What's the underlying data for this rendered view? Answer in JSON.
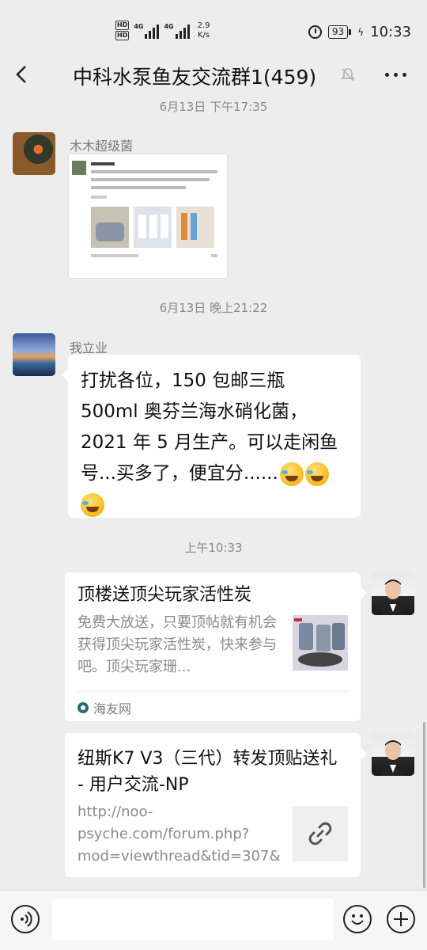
{
  "status_bar": {
    "hd1": "HD",
    "hd2": "HD",
    "net1": "4G",
    "net2": "4G",
    "speed_value": "2.9",
    "speed_unit": "K/s",
    "battery": "93",
    "time": "10:33"
  },
  "header": {
    "title": "中科水泵鱼友交流群1(459)"
  },
  "messages": {
    "time1": "6月13日 下午17:35",
    "msg1": {
      "sender": "木木超级菌",
      "type": "image"
    },
    "time2": "6月13日 晚上21:22",
    "msg2": {
      "sender": "我立业",
      "text": "打扰各位，150 包邮三瓶 500ml 奥芬兰海水硝化菌，2021 年 5 月生产。可以走闲鱼号...买多了，便宜分......"
    },
    "time3": "上午10:33",
    "msg3": {
      "title": "顶楼送顶尖玩家活性炭",
      "desc": "免费大放送，只要顶帖就有机会获得顶尖玩家活性炭，快来参与吧。顶尖玩家珊...",
      "source": "海友网"
    },
    "msg4": {
      "title": "纽斯K7 V3（三代）转发顶贴送礼 - 用户交流-NP",
      "desc": "http://noo-psyche.com/forum.php?mod=viewthread&tid=307&extr..."
    }
  },
  "input_bar": {
    "placeholder": ""
  }
}
